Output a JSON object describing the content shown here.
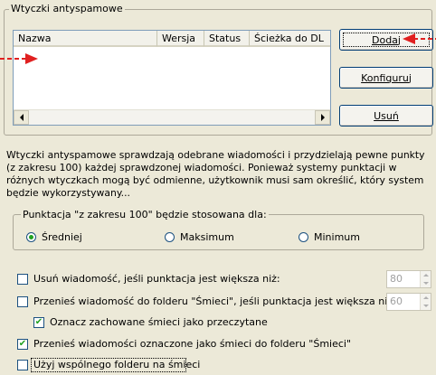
{
  "plugins_group": {
    "title": "Wtyczki antyspamowe",
    "columns": [
      "Nazwa",
      "Wersja",
      "Status",
      "Ścieżka do DL"
    ]
  },
  "buttons": {
    "add": "Dodaj",
    "configure": "Konfiguruj",
    "remove": "Usuń"
  },
  "description": "Wtyczki antyspamowe sprawdzają odebrane wiadomości i przydzielają pewne punkty (z zakresu 100) każdej sprawdzonej wiadomości. Ponieważ systemy punktacji w różnych wtyczkach mogą być odmienne, użytkownik musi sam określić, który system będzie wykorzystywany...",
  "score_group": {
    "title": "Punktacja \"z zakresu 100\" będzie stosowana dla:",
    "options": [
      "Średniej",
      "Maksimum",
      "Minimum"
    ],
    "selected": "Średniej"
  },
  "options": {
    "delete_label": "Usuń wiadomość, jeśli punktacja jest większa niż:",
    "delete_value": "80",
    "move_label": "Przenieś wiadomość do folderu \"Śmieci\", jeśli punktacja jest większa niż:",
    "move_value": "60",
    "mark_read_label": "Oznacz zachowane śmieci jako przeczytane",
    "move_marked_label": "Przenieś wiadomości oznaczone jako śmieci do folderu \"Śmieci\"",
    "shared_folder_label": "Użyj wspólnego folderu na śmieci"
  },
  "colors": {
    "annotation_arrow": "#e02020",
    "window_bg": "#ece9d8",
    "check_green": "#21a121"
  }
}
